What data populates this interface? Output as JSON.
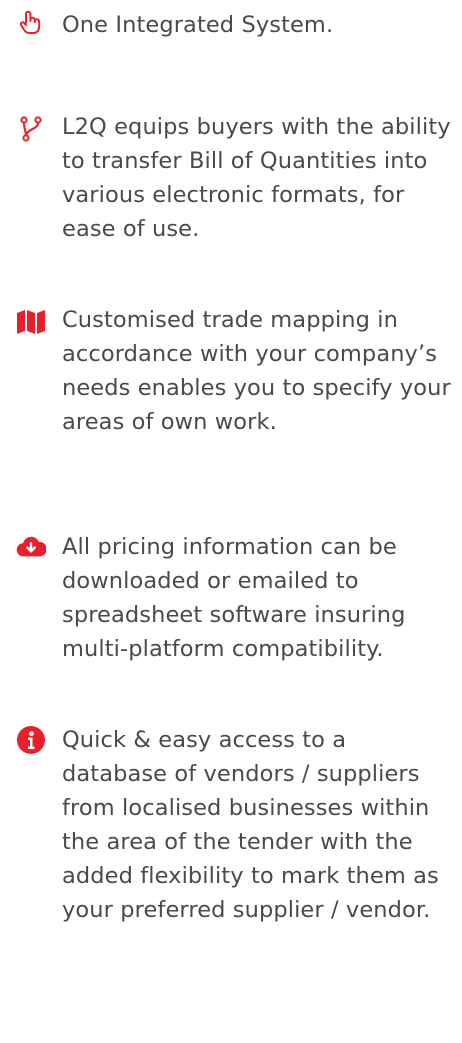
{
  "accent_color": "#e8202b",
  "text_color": "#4a4a4a",
  "features": [
    {
      "icon": "hand-pointer-icon",
      "text": "One Integrated System."
    },
    {
      "icon": "code-fork-icon",
      "text": "L2Q equips buyers with the ability to transfer Bill of Quantities into various electronic formats, for ease of use."
    },
    {
      "icon": "map-icon",
      "text": "Customised trade mapping in accordance with your company’s needs enables you to specify your areas of own work."
    },
    {
      "icon": "cloud-download-icon",
      "text": "All pricing information can be downloaded or emailed to spreadsheet software insuring multi-platform compatibility."
    },
    {
      "icon": "info-circle-icon",
      "text": "Quick & easy access to a database of vendors / suppliers from localised businesses within the area of the tender with the added flexibility to mark them as your preferred supplier / vendor."
    }
  ]
}
